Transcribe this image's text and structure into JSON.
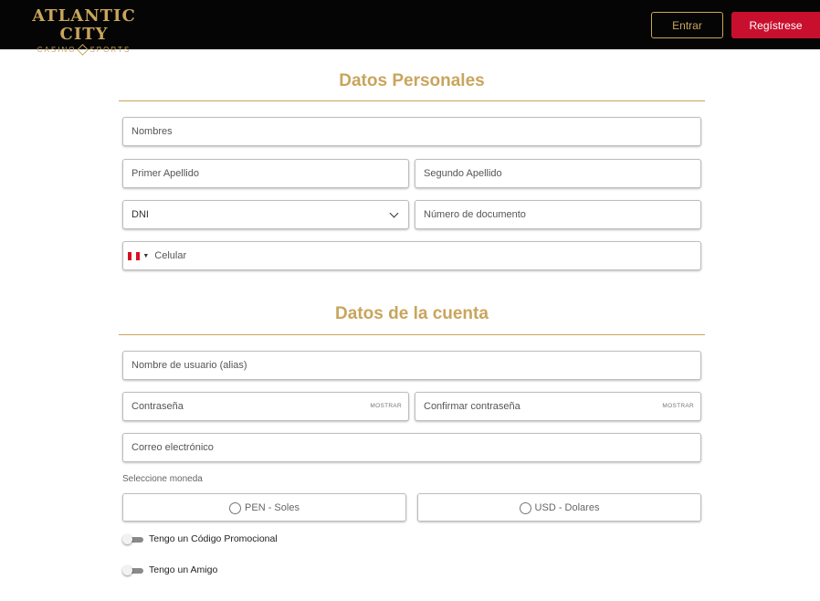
{
  "header": {
    "logo_main": "ATLANTIC CITY",
    "logo_sub_left": "CASINO",
    "logo_sub_right": "SPORTS",
    "login_label": "Entrar",
    "register_label": "Regístrese"
  },
  "personal": {
    "title": "Datos Personales",
    "first_names_placeholder": "Nombres",
    "first_surname_placeholder": "Primer Apellido",
    "second_surname_placeholder": "Segundo Apellido",
    "doc_type_value": "DNI",
    "doc_number_placeholder": "Número de documento",
    "phone_placeholder": "Celular",
    "phone_country": "peru-flag-icon"
  },
  "account": {
    "title": "Datos de la cuenta",
    "username_placeholder": "Nombre de usuario (alias)",
    "password_placeholder": "Contraseña",
    "password_show": "MOSTRAR",
    "confirm_placeholder": "Confirmar contraseña",
    "confirm_show": "MOSTRAR",
    "email_placeholder": "Correo electrónico",
    "currency_label": "Seleccione moneda",
    "currency_options": [
      "PEN - Soles",
      "USD - Dolares"
    ],
    "promo_toggle_label": "Tengo un Código Promocional",
    "friend_toggle_label": "Tengo un Amigo"
  },
  "colors": {
    "gold": "#c9a55c",
    "red": "#c8102e",
    "header_bg": "#050505"
  }
}
